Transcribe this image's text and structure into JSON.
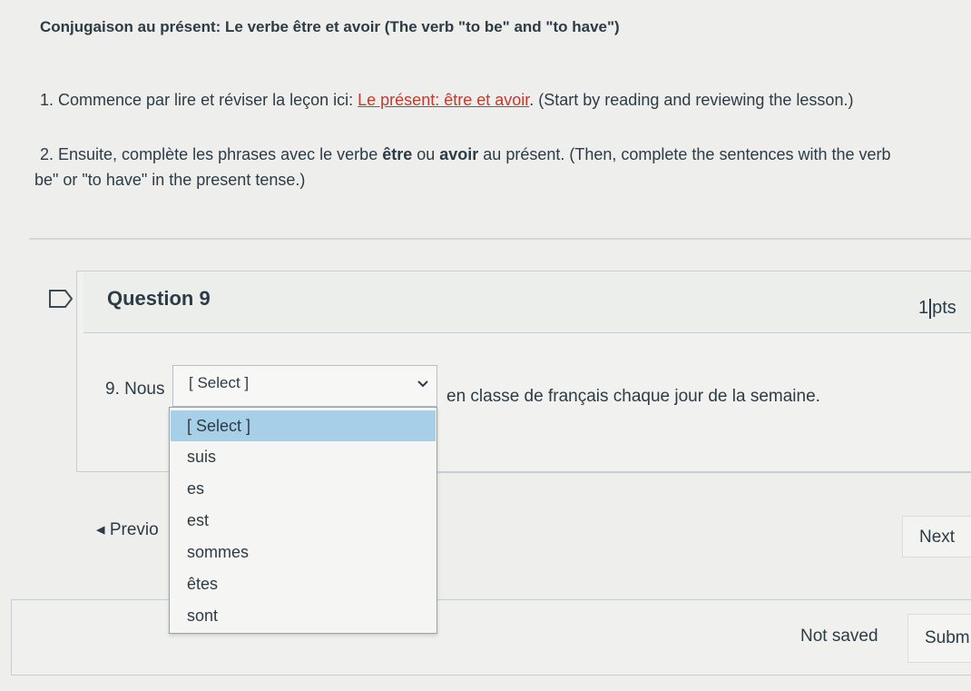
{
  "instructions": {
    "heading": "Conjugaison au présent: Le verbe être et avoir (The verb \"to be\" and \"to have\")",
    "step1_before": "1. Commence par lire et réviser la leçon ici: ",
    "step1_link": "Le présent: être et avoir",
    "step1_after": ". (Start by reading and reviewing the lesson.)",
    "step2_a": "2. Ensuite, complète les phrases avec le verbe ",
    "step2_b": "être",
    "step2_c": " ou ",
    "step2_d": "avoir",
    "step2_e": " au présent. (Then, complete the sentences with the verb",
    "step2_f": "be\" or \"to have\" in the present tense.)"
  },
  "question": {
    "title": "Question 9",
    "points_num": "1",
    "points_unit": "pts",
    "prefix": "9. Nous",
    "suffix": "en classe de français chaque jour de la semaine.",
    "selected": "[ Select ]",
    "options": [
      "[ Select ]",
      "suis",
      "es",
      "est",
      "sommes",
      "êtes",
      "sont"
    ],
    "highlighted_index": 0
  },
  "nav": {
    "previous": "◂ Previo",
    "next": "Next"
  },
  "footer": {
    "status": "Not saved",
    "submit": "Subm"
  },
  "colors": {
    "link": "#c23b2b",
    "highlight": "#a7cfe7",
    "text": "#2d3b45"
  }
}
